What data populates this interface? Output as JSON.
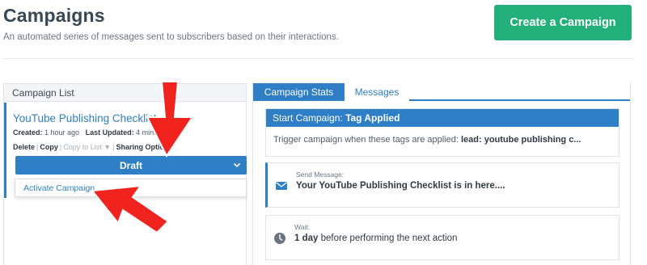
{
  "header": {
    "title": "Campaigns",
    "subtitle": "An automated series of messages sent to subscribers based on their interactions.",
    "create_button": "Create a Campaign"
  },
  "campaign_list": {
    "heading": "Campaign List",
    "campaign": {
      "title": "YouTube Publishing Checklist",
      "created_label": "Created:",
      "created_value": "1 hour ago",
      "updated_label": "Last Updated:",
      "updated_value": "4 minutes",
      "actions": {
        "delete": "Delete",
        "copy": "Copy",
        "copy_to_list": "Copy to List",
        "sharing": "Sharing Options"
      },
      "status_button": "Draft",
      "dropdown_option": "Activate Campaign"
    }
  },
  "tabs": [
    {
      "label": "Campaign Stats",
      "active": true
    },
    {
      "label": "Messages",
      "active": false
    }
  ],
  "start": {
    "label": "Start Campaign:",
    "trigger": "Tag Applied",
    "description": "Trigger campaign when these tags are applied:",
    "tags": "lead: youtube publishing c..."
  },
  "steps": [
    {
      "icon": "envelope-icon",
      "label": "Send Message:",
      "value": "Your YouTube Publishing Checklist is in here...."
    },
    {
      "icon": "clock-icon",
      "label": "Wait:",
      "value_bold": "1 day",
      "value_rest": "before performing the next action"
    }
  ],
  "colors": {
    "accent": "#2f7fc6",
    "create_button": "#23b07a",
    "annotation_arrow": "#f0231e"
  }
}
